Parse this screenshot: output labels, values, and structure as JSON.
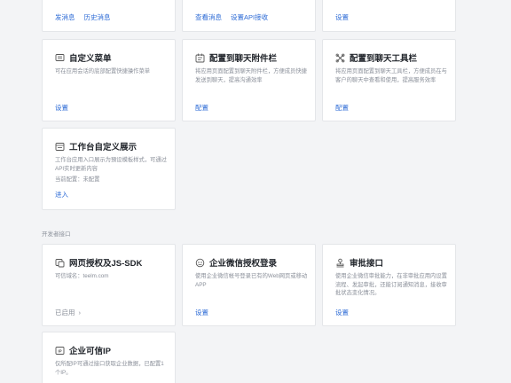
{
  "top_row": {
    "card1_links": [
      "发消息",
      "历史消息"
    ],
    "card2_links": [
      "查看消息",
      "设置API接收"
    ],
    "card3_links": [
      "设置"
    ]
  },
  "custom_features": [
    {
      "icon": "menu-icon",
      "title": "自定义菜单",
      "desc": "可在应用会话的底部配置快捷操作菜单",
      "link": "设置"
    },
    {
      "icon": "attachment-panel-icon",
      "title": "配置到聊天附件栏",
      "desc": "将应用页面配置到聊天附件栏，方便成员快捷发送到聊天，提高沟通效率",
      "link": "配置"
    },
    {
      "icon": "toolbar-icon",
      "title": "配置到聊天工具栏",
      "desc": "将应用页面配置到聊天工具栏，方便成员在与客户的聊天中查看和使用，提高服务效率",
      "link": "配置"
    },
    {
      "icon": "workbench-icon",
      "title": "工作台自定义展示",
      "desc": "工作台应用入口展示为預设模板样式，可通过API实时更新内容",
      "current": "当前配置：未配置",
      "link": "进入"
    }
  ],
  "dev_section_label": "开发者接口",
  "dev_interfaces": [
    {
      "icon": "web-auth-icon",
      "title": "网页授权及JS-SDK",
      "desc": "可信域名：teelm.com",
      "link": "已启用",
      "link_suffix": "›"
    },
    {
      "icon": "wecom-login-icon",
      "title": "企业微信授权登录",
      "desc": "使用企业微信帐号登录已有的Web网页或移动APP",
      "link": "设置"
    },
    {
      "icon": "approval-icon",
      "title": "审批接口",
      "desc": "使用企业微信审批能力，在非审批应用内设置流程、发起审批，还能订阅通知消息，接收审批状态变化情况。",
      "link": "设置"
    },
    {
      "icon": "trusted-ip-icon",
      "title": "企业可信IP",
      "desc": "仅所配IP可通过接口获取企业数据，已配置1个IP。"
    }
  ],
  "colors": {
    "link": "#2d6bd6",
    "muted": "#8a8f99",
    "background": "#f3f4f6"
  }
}
